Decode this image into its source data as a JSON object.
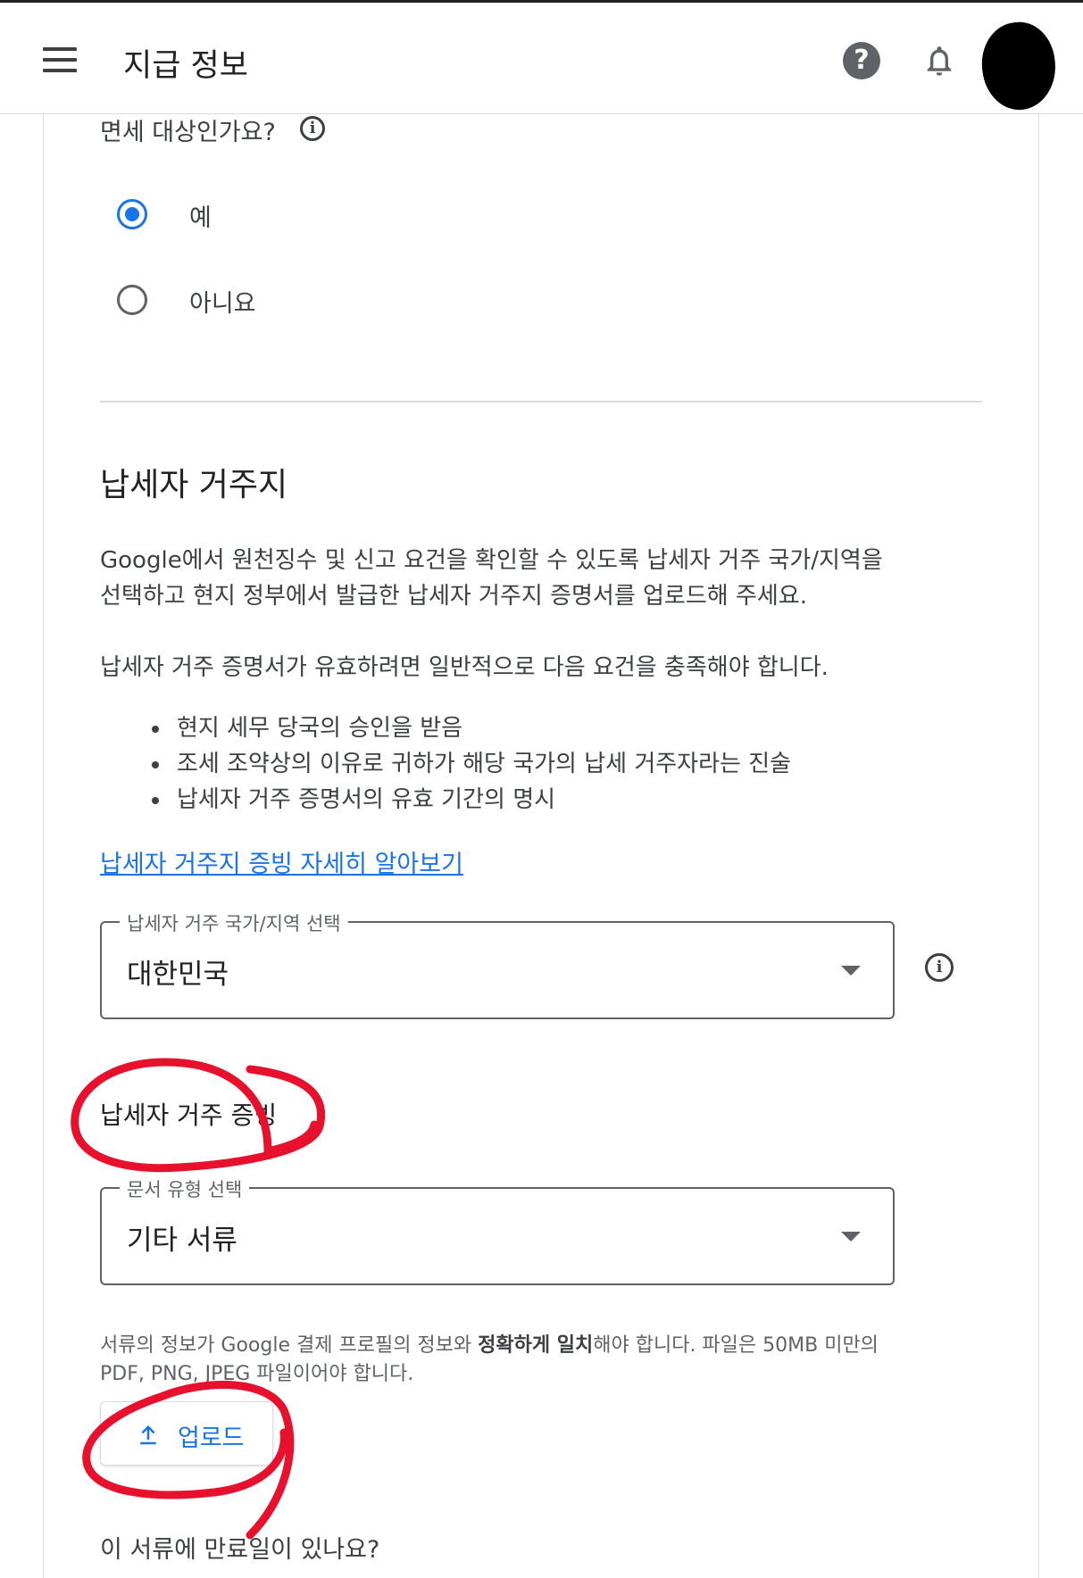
{
  "header": {
    "title": "지급 정보",
    "menu_icon": "menu-icon",
    "help_icon": "help-icon",
    "bell_icon": "notification-bell-icon"
  },
  "tax_exempt": {
    "question": "면세 대상인가요?",
    "options": [
      {
        "label": "예",
        "selected": true
      },
      {
        "label": "아니요",
        "selected": false
      }
    ]
  },
  "residency": {
    "title": "납세자 거주지",
    "description": "Google에서 원천징수 및 신고 요건을 확인할 수 있도록 납세자 거주 국가/지역을 선택하고 현지 정부에서 발급한 납세자 거주지 증명서를 업로드해 주세요.",
    "requirements_intro": "납세자 거주 증명서가 유효하려면 일반적으로 다음 요건을 충족해야 합니다.",
    "requirements": [
      "현지 세무 당국의 승인을 받음",
      "조세 조약상의 이유로 귀하가 해당 국가의 납세 거주자라는 진술",
      "납세자 거주 증명서의 유효 기간의 명시"
    ],
    "learn_more_link": "납세자 거주지 증빙 자세히 알아보기",
    "country_field": {
      "label": "납세자 거주 국가/지역 선택",
      "value": "대한민국"
    }
  },
  "proof": {
    "title": "납세자 거주 증빙",
    "doc_type_field": {
      "label": "문서 유형 선택",
      "value": "기타 서류"
    },
    "hint_before": "서류의 정보가 Google 결제 프로필의 정보와 ",
    "hint_bold": "정확하게 일치",
    "hint_after": "해야 합니다. 파일은 50MB 미만의 PDF, PNG, JPEG 파일이어야 합니다.",
    "upload_label": "업로드",
    "expiry_question": "이 서류에 만료일이 있나요?"
  },
  "colors": {
    "accent": "#1a73e8",
    "annotation": "#e8112d"
  }
}
